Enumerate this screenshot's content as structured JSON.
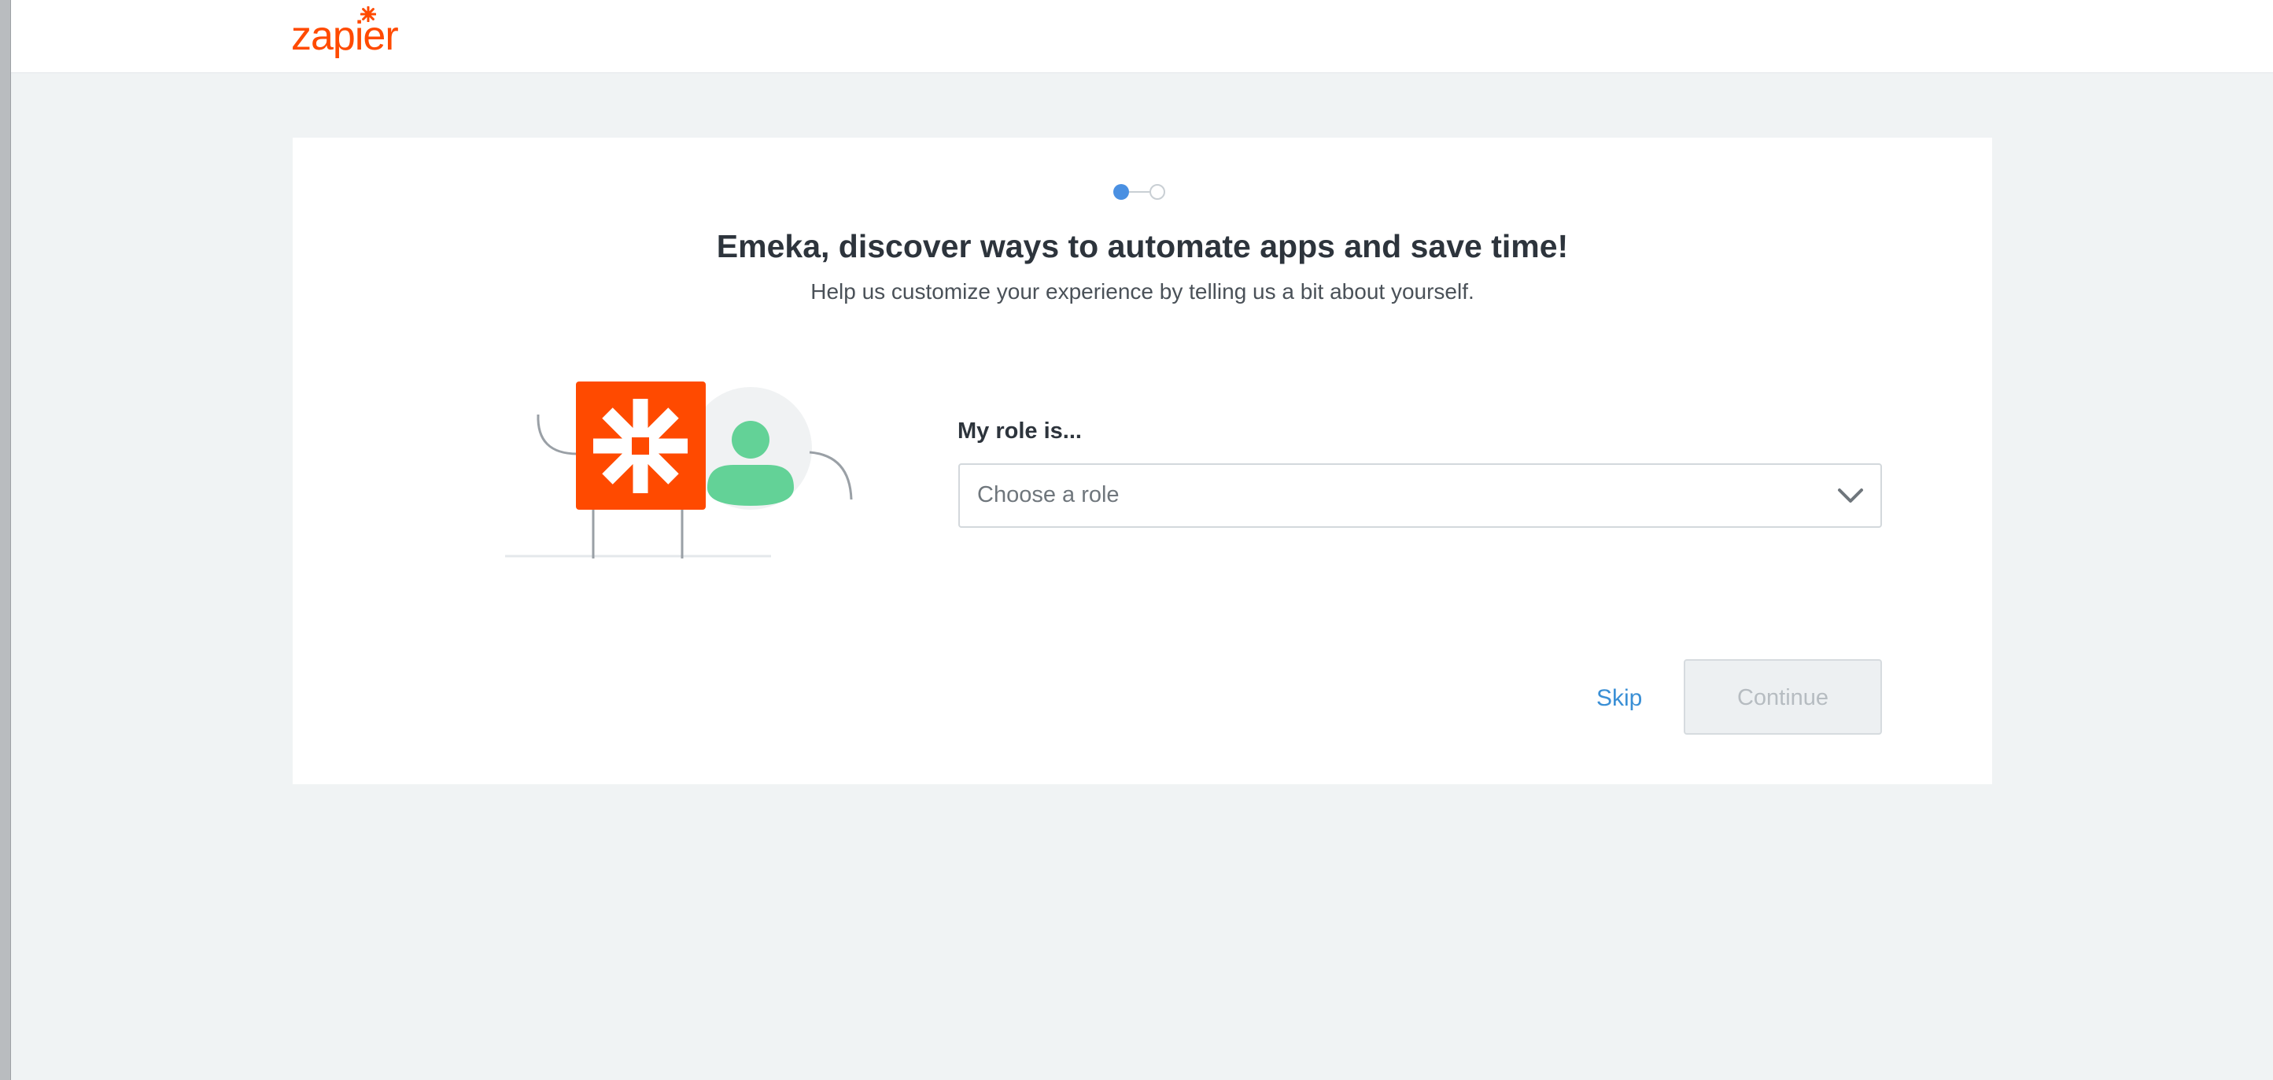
{
  "brand": {
    "logo_text": "zapier",
    "accent_color": "#ff4a00",
    "logo_icon": "asterisk-icon"
  },
  "stepper": {
    "current_step": 1,
    "total_steps": 2,
    "active_color": "#4a90e2"
  },
  "onboarding": {
    "headline": "Emeka, discover ways to automate apps and save time!",
    "subline": "Help us customize your experience by telling us a bit about yourself."
  },
  "illustration": {
    "icons": [
      "zapier-asterisk-icon",
      "user-avatar-icon"
    ],
    "colors": {
      "orange": "#ff4a00",
      "green": "#63d297",
      "gray": "#9aa0a6"
    }
  },
  "role_form": {
    "label": "My role is...",
    "placeholder": "Choose a role",
    "dropdown_icon": "chevron-down-icon"
  },
  "actions": {
    "skip_label": "Skip",
    "continue_label": "Continue",
    "continue_disabled": true
  }
}
